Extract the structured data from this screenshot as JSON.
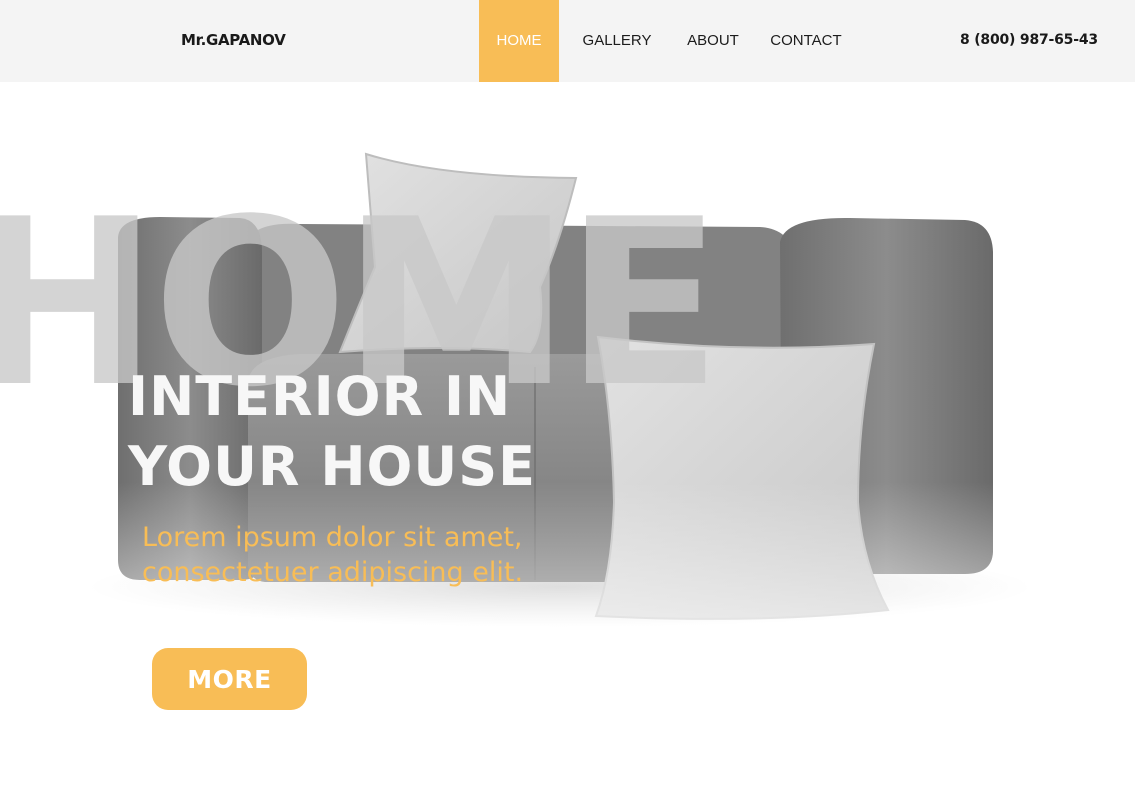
{
  "header": {
    "logo": "Mr.GAPANOV",
    "nav": [
      {
        "label": "HOME",
        "active": true
      },
      {
        "label": "GALLERY",
        "active": false
      },
      {
        "label": "ABOUT",
        "active": false
      },
      {
        "label": "CONTACT",
        "active": false
      }
    ],
    "phone": "8 (800) 987-65-43"
  },
  "hero": {
    "watermark": "HOME",
    "headline_lines": [
      "INTERIOR IN",
      "YOUR HOUSE"
    ],
    "subtitle_lines": [
      "Lorem ipsum dolor sit amet,",
      "consectetuer adipiscing elit."
    ],
    "button_label": "MORE",
    "image": "grey-sofa-with-white-pillows"
  },
  "colors": {
    "accent": "#f8bd56",
    "header_bg": "#f4f4f4",
    "text_dark": "#1a1a1a"
  }
}
